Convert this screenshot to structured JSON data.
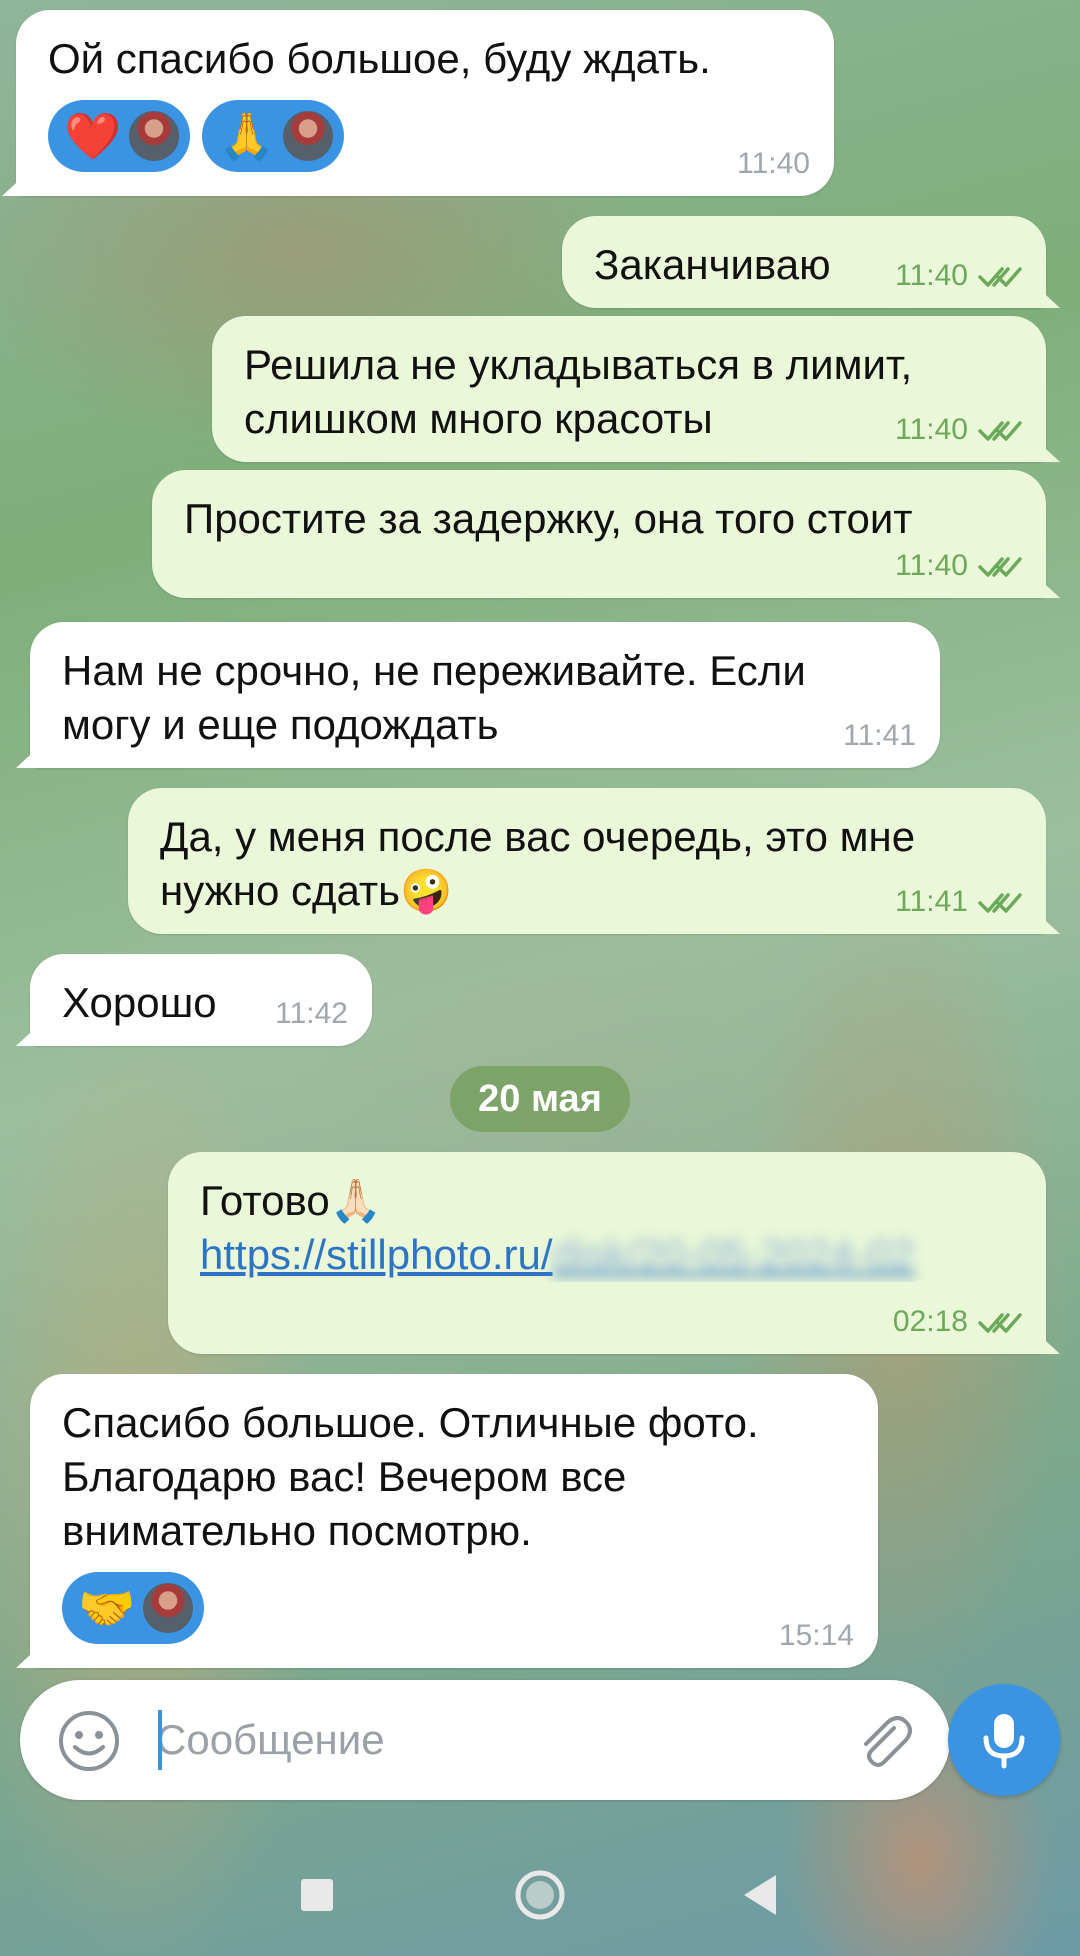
{
  "messages": [
    {
      "text": "Ой спасибо большое, буду ждать.",
      "time": "11:40",
      "reactions": [
        {
          "emoji": "❤️",
          "icon": "heart-icon"
        },
        {
          "emoji": "🙏",
          "icon": "folded-hands-icon"
        }
      ]
    },
    {
      "text": "Заканчиваю",
      "time": "11:40"
    },
    {
      "text": "Решила не укладываться в лимит,\nслишком много красоты",
      "time": "11:40"
    },
    {
      "text": "Простите за задержку, она того стоит",
      "time": "11:40"
    },
    {
      "text": "Нам не срочно, не переживайте. Если\nмогу и еще подождать",
      "time": "11:41"
    },
    {
      "text": "Да, у меня после вас очередь, это мне\nнужно сдать🤪",
      "time": "11:41"
    },
    {
      "text": "Хорошо",
      "time": "11:42"
    },
    {
      "text": "Готово🙏🏻",
      "link": "https://stillphoto.ru/",
      "link_hidden": "disk/20-05-2024-02",
      "time": "02:18"
    },
    {
      "text": "Спасибо большое. Отличные фото.\nБлагодарю вас! Вечером все\nвнимательно посмотрю.",
      "time": "15:14",
      "reactions": [
        {
          "emoji": "🤝",
          "icon": "handshake-icon"
        }
      ]
    }
  ],
  "date_separator": "20 мая",
  "composer": {
    "placeholder": "Сообщение"
  },
  "colors": {
    "accent": "#3a93e3",
    "outgoing_bubble": "#eaf7d8",
    "incoming_bubble": "#ffffff",
    "read_check": "#6ca95a"
  }
}
